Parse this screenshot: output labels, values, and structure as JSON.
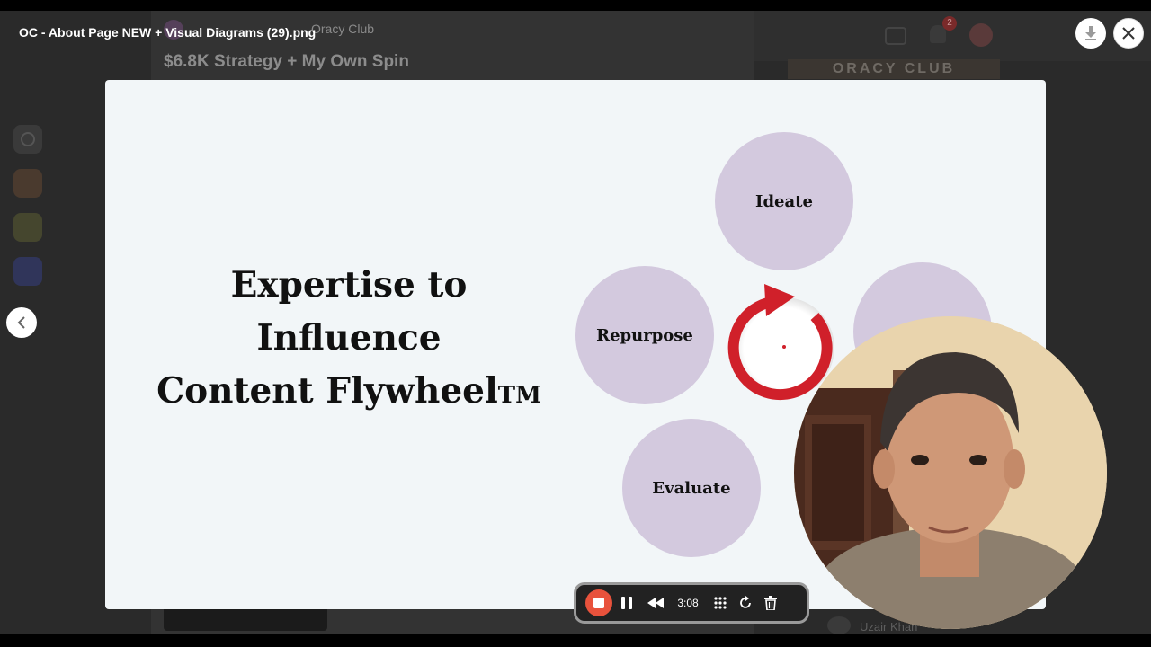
{
  "viewer": {
    "file_title": "OC - About Page NEW + Visual Diagrams (29).png"
  },
  "background_page": {
    "group_name": "Oracy Club",
    "post_title": "$6.8K Strategy + My Own Spin",
    "notification_count": "2",
    "banner_text": "ORACY CLUB",
    "commenter_name": "Uzair Khan"
  },
  "slide": {
    "title_line1": "Expertise to",
    "title_line2": "Influence",
    "title_line3": "Content Flywheel",
    "trademark": "TM",
    "circles": {
      "ideate": "Ideate",
      "repurpose": "Repurpose",
      "evaluate": "Evaluate"
    },
    "colors": {
      "circle_fill": "#d3c9de",
      "cycle_arrow": "#d0202a"
    }
  },
  "recorder": {
    "elapsed": "3:08",
    "stop_color": "#e8523c"
  },
  "icons": {
    "download": "download-icon",
    "close": "close-icon",
    "prev": "chevron-left-icon",
    "pause": "pause-icon",
    "rewind": "rewind-icon",
    "grid": "grid-icon",
    "restart": "restart-icon",
    "trash": "trash-icon"
  }
}
